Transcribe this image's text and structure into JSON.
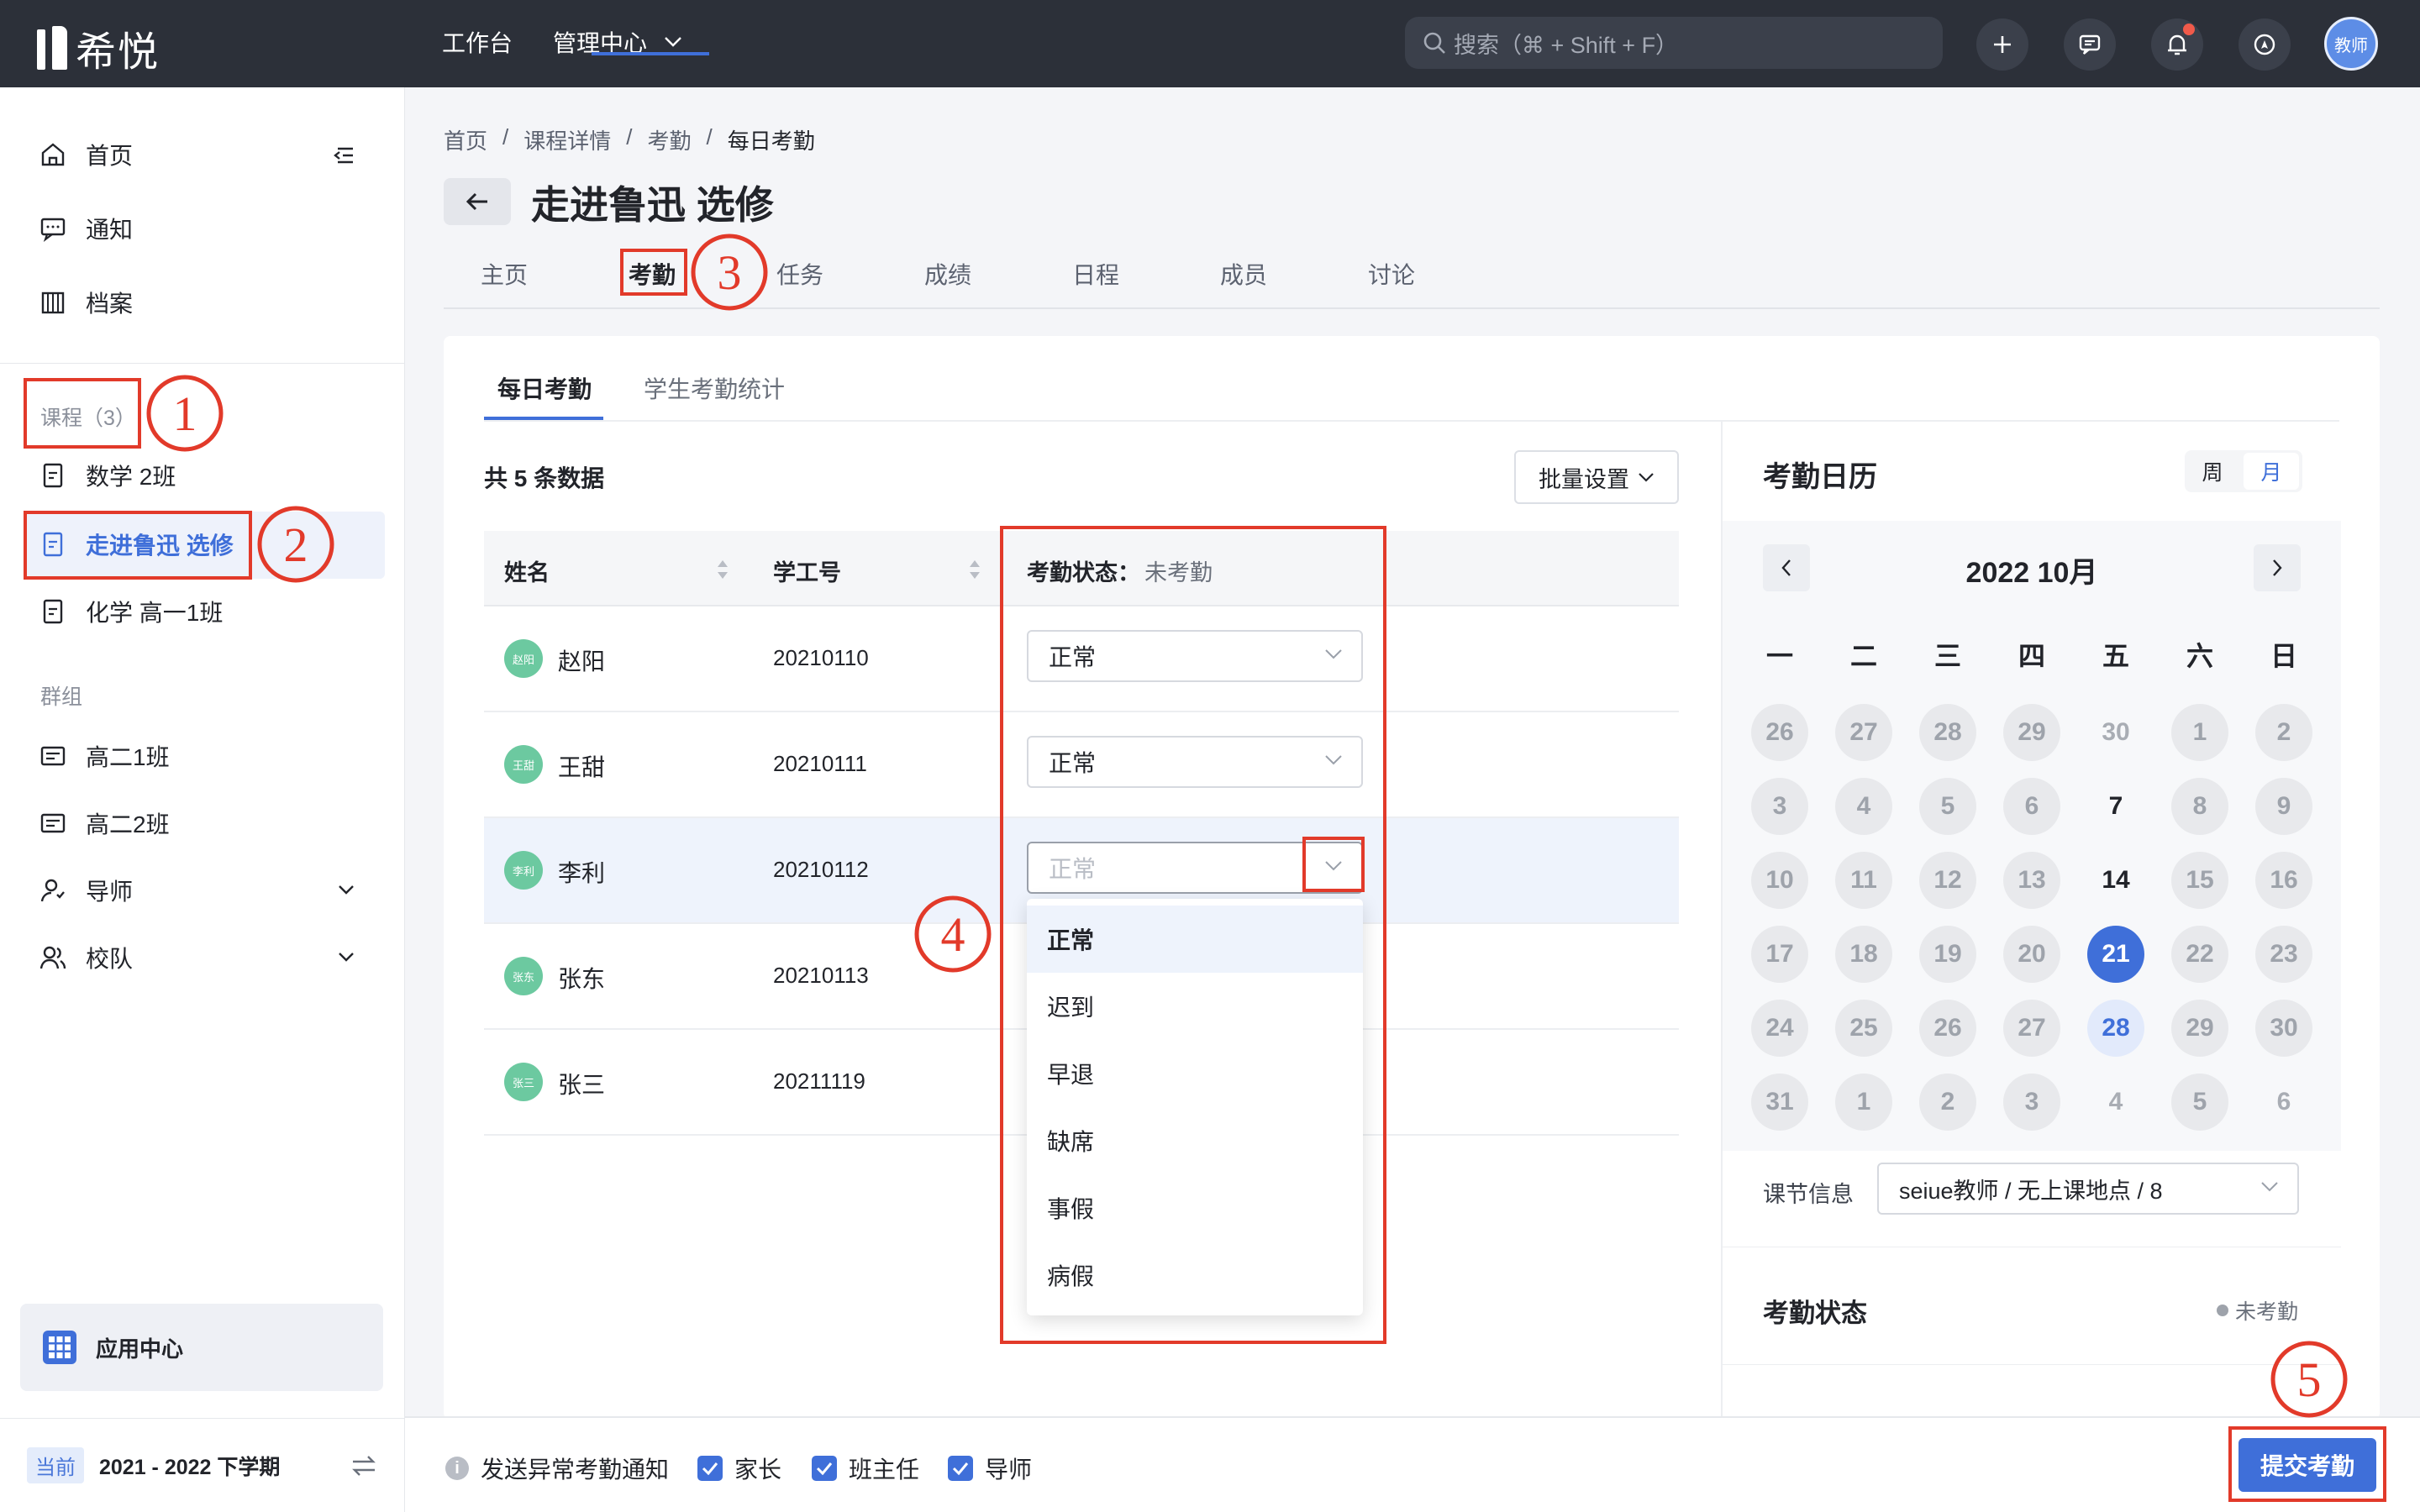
{
  "app": {
    "logo_text": "希悦"
  },
  "topbar": {
    "nav": [
      "工作台",
      "管理中心"
    ],
    "search_placeholder": "搜索（⌘ + Shift + F）",
    "avatar_text": "教师"
  },
  "sidebar": {
    "top_items": [
      "首页",
      "通知",
      "档案"
    ],
    "course_heading": "课程（3）",
    "courses": [
      "数学 2班",
      "走进鲁迅 选修",
      "化学 高一1班"
    ],
    "group_heading": "群组",
    "groups": [
      "高二1班",
      "高二2班",
      "导师",
      "校队"
    ],
    "app_center": "应用中心",
    "term_tag": "当前",
    "term": "2021 - 2022 下学期"
  },
  "breadcrumb": [
    "首页",
    "课程详情",
    "考勤",
    "每日考勤"
  ],
  "page": {
    "title": "走进鲁迅 选修"
  },
  "tabs": [
    "主页",
    "考勤",
    "任务",
    "成绩",
    "日程",
    "成员",
    "讨论"
  ],
  "subtabs": [
    "每日考勤",
    "学生考勤统计"
  ],
  "table": {
    "total": "共 5 条数据",
    "batch_label": "批量设置",
    "col_name": "姓名",
    "col_id": "学工号",
    "col_status": "考勤状态：",
    "col_status_value": "未考勤",
    "rows": [
      {
        "name": "赵阳",
        "avatar": "赵阳",
        "id": "20210110",
        "status": "正常"
      },
      {
        "name": "王甜",
        "avatar": "王甜",
        "id": "20210111",
        "status": "正常"
      },
      {
        "name": "李利",
        "avatar": "李利",
        "id": "20210112",
        "status": "正常"
      },
      {
        "name": "张东",
        "avatar": "张东",
        "id": "20210113",
        "status": ""
      },
      {
        "name": "张三",
        "avatar": "张三",
        "id": "20211119",
        "status": ""
      }
    ],
    "options": [
      "正常",
      "迟到",
      "早退",
      "缺席",
      "事假",
      "病假"
    ]
  },
  "calendar": {
    "title": "考勤日历",
    "toggle": [
      "周",
      "月"
    ],
    "month_label": "2022 10月",
    "weekdays": [
      "一",
      "二",
      "三",
      "四",
      "五",
      "六",
      "日"
    ],
    "days": [
      [
        "26",
        "27",
        "28",
        "29",
        "30",
        "1",
        "2"
      ],
      [
        "3",
        "4",
        "5",
        "6",
        "7",
        "8",
        "9"
      ],
      [
        "10",
        "11",
        "12",
        "13",
        "14",
        "15",
        "16"
      ],
      [
        "17",
        "18",
        "19",
        "20",
        "21",
        "22",
        "23"
      ],
      [
        "24",
        "25",
        "26",
        "27",
        "28",
        "29",
        "30"
      ],
      [
        "31",
        "1",
        "2",
        "3",
        "4",
        "5",
        "6"
      ]
    ],
    "lesson_label": "课节信息",
    "lesson_value": "seiue教师 / 无上课地点 / 8",
    "status_title": "考勤状态",
    "status_legend": "未考勤"
  },
  "footer": {
    "notify_label": "发送异常考勤通知",
    "checks": [
      "家长",
      "班主任",
      "导师"
    ],
    "submit": "提交考勤"
  },
  "annotations": [
    "1",
    "2",
    "3",
    "4",
    "5"
  ],
  "colors": {
    "accent": "#3f6fd9",
    "annotation": "#e23a2a",
    "topbar": "#2c3039"
  }
}
